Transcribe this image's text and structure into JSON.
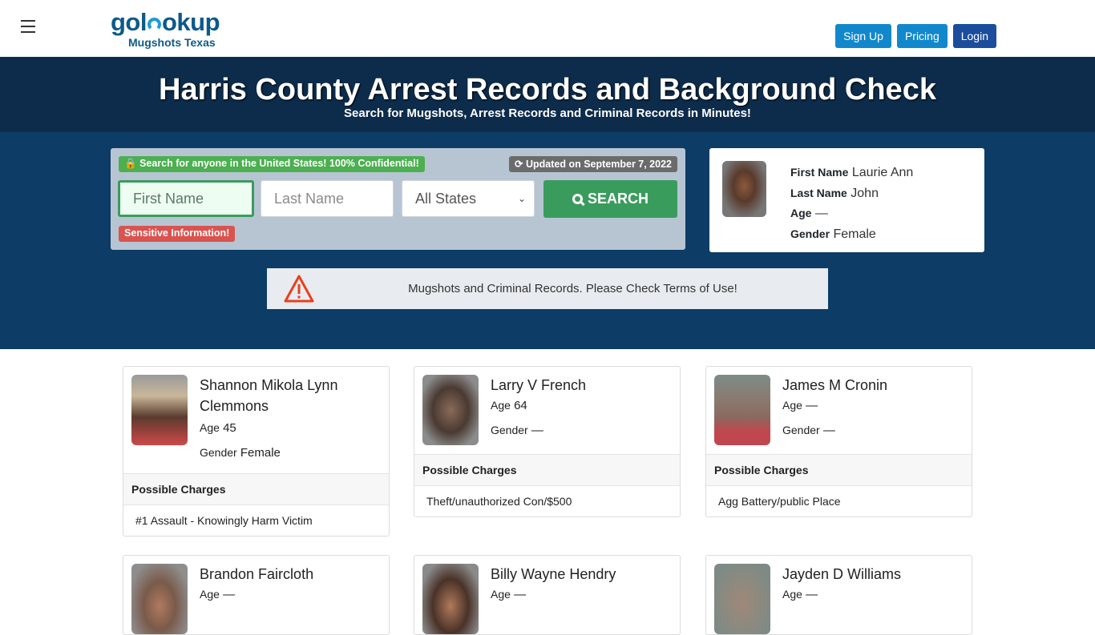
{
  "header": {
    "menu_icon": "hamburger-icon",
    "logo_text_pre": "gol",
    "logo_text_post": "okup",
    "logo_subtitle": "Mugshots Texas",
    "buttons": {
      "signup": "Sign Up",
      "pricing": "Pricing",
      "login": "Login"
    }
  },
  "hero": {
    "title": "Harris County Arrest Records and Background Check",
    "subtitle": "Search for Mugshots, Arrest Records and Criminal Records in Minutes!"
  },
  "search": {
    "confidential_badge": "Search for anyone in the United States! 100% Confidential!",
    "updated_badge": "Updated on September 7, 2022",
    "first_name_placeholder": "First Name",
    "last_name_placeholder": "Last Name",
    "state_selected": "All States",
    "search_button": "SEARCH",
    "sensitive_badge": "Sensitive Information!"
  },
  "featured": {
    "first_name_label": "First Name",
    "first_name": "Laurie Ann",
    "last_name_label": "Last Name",
    "last_name": "John",
    "age_label": "Age",
    "age": "—",
    "gender_label": "Gender",
    "gender": "Female"
  },
  "notice": {
    "text": "Mugshots and Criminal Records. Please Check Terms of Use!"
  },
  "records": [
    {
      "name": "Shannon Mikola Lynn Clemmons",
      "age": "45",
      "gender": "Female",
      "charges_label": "Possible Charges",
      "charges": [
        "#1 Assault - Knowingly Harm Victim"
      ]
    },
    {
      "name": "Larry V French",
      "age": "64",
      "gender": "—",
      "charges_label": "Possible Charges",
      "charges": [
        "Theft/unauthorized Con/$500"
      ]
    },
    {
      "name": "James M Cronin",
      "age": "—",
      "gender": "—",
      "charges_label": "Possible Charges",
      "charges": [
        "Agg Battery/public Place"
      ]
    },
    {
      "name": "Brandon Faircloth",
      "age": "—"
    },
    {
      "name": "Billy Wayne Hendry",
      "age": "—"
    },
    {
      "name": "Jayden D Williams",
      "age": "—"
    }
  ],
  "labels": {
    "age": "Age",
    "gender": "Gender"
  }
}
